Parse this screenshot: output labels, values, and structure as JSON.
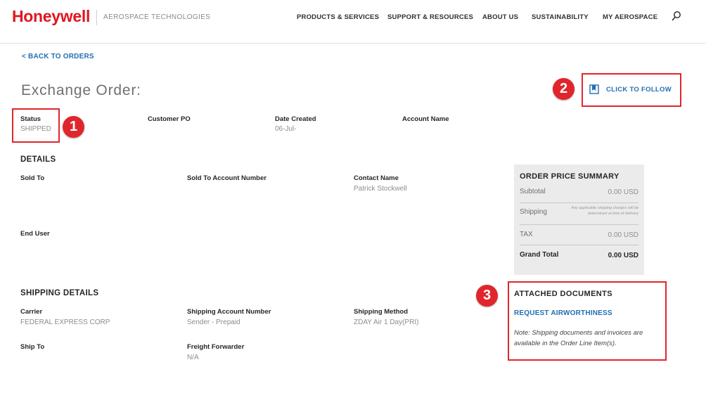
{
  "header": {
    "logo": "Honeywell",
    "tagline": "AEROSPACE TECHNOLOGIES",
    "nav": [
      "PRODUCTS & SERVICES",
      "SUPPORT & RESOURCES",
      "ABOUT US",
      "SUSTAINABILITY",
      "MY AEROSPACE"
    ],
    "search_icon": "search-icon",
    "brand_color": "#e0151f"
  },
  "back_link": "< BACK TO ORDERS",
  "page_title": "Exchange Order:",
  "follow_label": "CLICK TO FOLLOW",
  "annotations": [
    "1",
    "2",
    "3"
  ],
  "order": {
    "status_label": "Status",
    "status_value": "SHIPPED",
    "customer_po_label": "Customer PO",
    "date_created_label": "Date Created",
    "date_created_value": "06-Jul-",
    "account_name_label": "Account Name"
  },
  "details": {
    "heading": "DETAILS",
    "sold_to_label": "Sold To",
    "sold_to_account_label": "Sold To Account Number",
    "contact_name_label": "Contact Name",
    "contact_name_value": "Patrick Stockwell",
    "end_user_label": "End User"
  },
  "summary": {
    "title": "ORDER PRICE SUMMARY",
    "subtotal_label": "Subtotal",
    "subtotal_value": "0.00 USD",
    "shipping_label": "Shipping",
    "shipping_note": "Any applicable shipping charges will be determined at time of delivery",
    "tax_label": "TAX",
    "tax_value": "0.00 USD",
    "grand_total_label": "Grand Total",
    "grand_total_value": "0.00 USD"
  },
  "shipping": {
    "heading": "SHIPPING DETAILS",
    "carrier_label": "Carrier",
    "carrier_value": "FEDERAL EXPRESS CORP",
    "account_label": "Shipping Account Number",
    "account_value": "Sender - Prepaid",
    "method_label": "Shipping Method",
    "method_value": "ZDAY Air 1 Day(PRI)",
    "ship_to_label": "Ship To",
    "forwarder_label": "Freight Forwarder",
    "forwarder_value": "N/A"
  },
  "documents": {
    "title": "ATTACHED DOCUMENTS",
    "link": "REQUEST AIRWORTHINESS",
    "note": "Note: Shipping documents and invoices are available in the Order Line Item(s)."
  },
  "colors": {
    "accent_red": "#e0262c",
    "link_blue": "#1f6fb2",
    "summary_bg": "#ebebeb"
  }
}
